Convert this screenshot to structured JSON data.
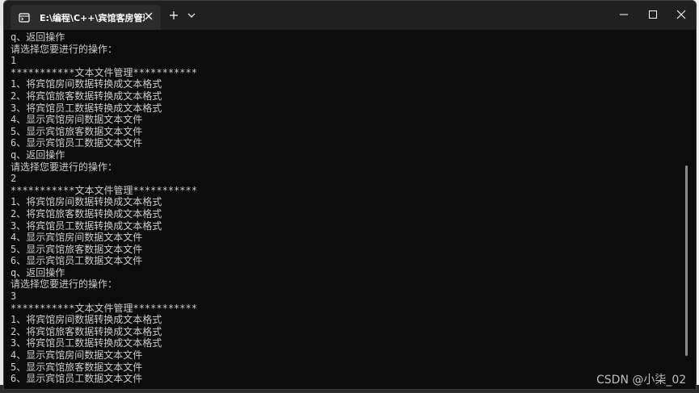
{
  "window": {
    "tab_title": "E:\\编程\\C++\\宾馆客房管理系统"
  },
  "console_lines": [
    "q、返回操作",
    "请选择您要进行的操作：",
    "1",
    "***********文本文件管理***********",
    "1、将宾馆房间数据转换成文本格式",
    "2、将宾馆旅客数据转换成文本格式",
    "3、将宾馆员工数据转换成文本格式",
    "4、显示宾馆房间数据文本文件",
    "5、显示宾馆旅客数据文本文件",
    "6、显示宾馆员工数据文本文件",
    "q、返回操作",
    "请选择您要进行的操作：",
    "2",
    "***********文本文件管理***********",
    "1、将宾馆房间数据转换成文本格式",
    "2、将宾馆旅客数据转换成文本格式",
    "3、将宾馆员工数据转换成文本格式",
    "4、显示宾馆房间数据文本文件",
    "5、显示宾馆旅客数据文本文件",
    "6、显示宾馆员工数据文本文件",
    "q、返回操作",
    "请选择您要进行的操作：",
    "3",
    "***********文本文件管理***********",
    "1、将宾馆房间数据转换成文本格式",
    "2、将宾馆旅客数据转换成文本格式",
    "3、将宾馆员工数据转换成文本格式",
    "4、显示宾馆房间数据文本文件",
    "5、显示宾馆旅客数据文本文件",
    "6、显示宾馆员工数据文本文件"
  ],
  "watermark": "CSDN @小柒_02",
  "colors": {
    "console_bg": "#0c0c0c",
    "console_fg": "#cccccc",
    "titlebar_bg": "#202020",
    "tab_bg": "#2c2c2c"
  },
  "icons": {
    "tab_icon": "terminal-icon",
    "close": "close-icon",
    "new_tab": "plus-icon",
    "dropdown": "chevron-down-icon",
    "minimize": "minimize-icon",
    "maximize": "maximize-icon",
    "window_close": "window-close-icon"
  }
}
